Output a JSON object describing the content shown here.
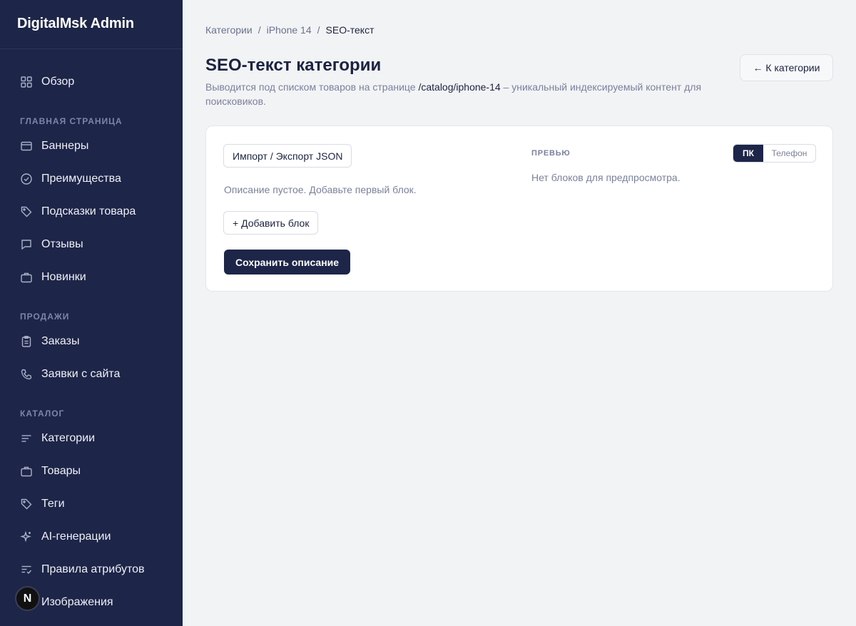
{
  "sidebar": {
    "brand": "DigitalMsk Admin",
    "overview": {
      "label": "Обзор",
      "icon": "grid-icon"
    },
    "sections": [
      {
        "title": "ГЛАВНАЯ СТРАНИЦА"
      },
      {
        "title": "ПРОДАЖИ"
      },
      {
        "title": "КАТАЛОГ"
      }
    ],
    "items": [
      {
        "label": "Баннеры",
        "icon": "banner-icon"
      },
      {
        "label": "Преимущества",
        "icon": "check-circle-icon"
      },
      {
        "label": "Подсказки товара",
        "icon": "tag-icon"
      },
      {
        "label": "Отзывы",
        "icon": "chat-icon"
      },
      {
        "label": "Новинки",
        "icon": "briefcase-icon"
      },
      {
        "label": "Заказы",
        "icon": "clipboard-icon"
      },
      {
        "label": "Заявки с сайта",
        "icon": "phone-icon"
      },
      {
        "label": "Категории",
        "icon": "list-icon"
      },
      {
        "label": "Товары",
        "icon": "briefcase-icon"
      },
      {
        "label": "Теги",
        "icon": "tag-icon"
      },
      {
        "label": "AI-генерации",
        "icon": "sparkle-icon"
      },
      {
        "label": "Правила атрибутов",
        "icon": "checklist-icon"
      },
      {
        "label": "Изображения",
        "icon": "image-icon"
      }
    ],
    "avatar": "N"
  },
  "breadcrumb": {
    "items": [
      "Категории",
      "iPhone 14",
      "SEO-текст"
    ],
    "separator": "/"
  },
  "header": {
    "title": "SEO-текст категории",
    "subtitle_before": "Выводится под списком товаров на странице ",
    "subtitle_path": "/catalog/iphone-14",
    "subtitle_after": " – уникальный индексируемый контент для поисковиков.",
    "back_label": "← К категории"
  },
  "editor": {
    "import_export_label": "Импорт / Экспорт JSON",
    "empty_text": "Описание пустое. Добавьте первый блок.",
    "add_block_label": "+ Добавить блок",
    "save_label": "Сохранить описание"
  },
  "preview": {
    "label": "ПРЕВЬЮ",
    "modes": [
      "ПК",
      "Телефон"
    ],
    "active_mode": "ПК",
    "empty_text": "Нет блоков для предпросмотра."
  },
  "colors": {
    "sidebar_bg": "#1d2548",
    "page_bg": "#f2f3f5",
    "primary": "#1d2548"
  }
}
